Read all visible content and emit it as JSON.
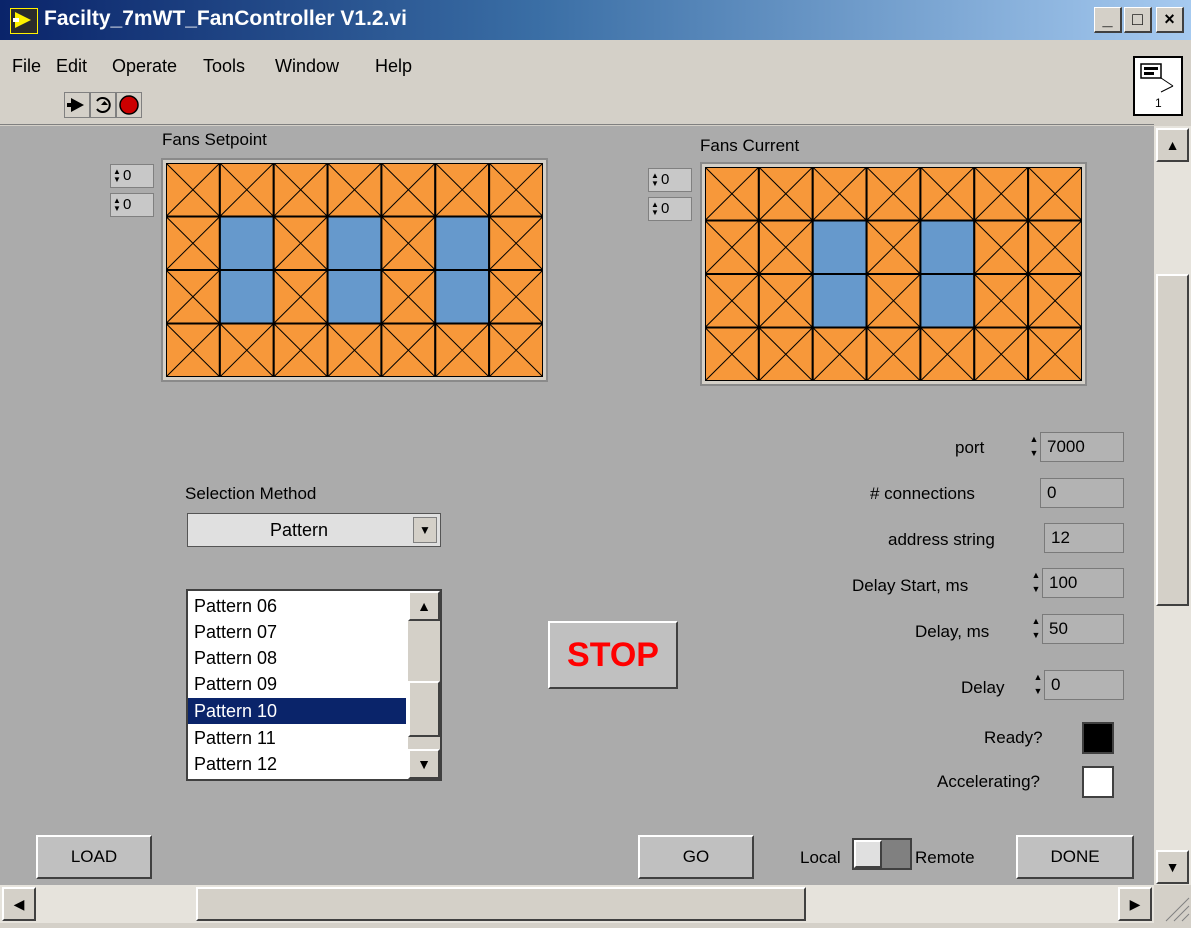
{
  "window": {
    "title": "Facilty_7mWT_FanController V1.2.vi",
    "controls": {
      "minimize": "_",
      "maximize": "□",
      "close": "×"
    }
  },
  "menu": [
    "File",
    "Edit",
    "Operate",
    "Tools",
    "Window",
    "Help"
  ],
  "toolbar": {
    "icons": [
      "run-icon",
      "run-continuously-icon",
      "abort-icon"
    ]
  },
  "vi_icon_label": "1",
  "fans_setpoint": {
    "label": "Fans Setpoint",
    "index_row": "0",
    "index_col": "0",
    "rows": 4,
    "cols": 7,
    "grid": [
      [
        0,
        0,
        0,
        0,
        0,
        0,
        0
      ],
      [
        0,
        1,
        0,
        1,
        0,
        1,
        0
      ],
      [
        0,
        1,
        0,
        1,
        0,
        1,
        0
      ],
      [
        0,
        0,
        0,
        0,
        0,
        0,
        0
      ]
    ]
  },
  "fans_current": {
    "label": "Fans Current",
    "index_row": "0",
    "index_col": "0",
    "rows": 4,
    "cols": 7,
    "grid": [
      [
        0,
        0,
        0,
        0,
        0,
        0,
        0
      ],
      [
        0,
        0,
        1,
        0,
        1,
        0,
        0
      ],
      [
        0,
        0,
        1,
        0,
        1,
        0,
        0
      ],
      [
        0,
        0,
        0,
        0,
        0,
        0,
        0
      ]
    ]
  },
  "colors": {
    "fan_off": "#f7983a",
    "fan_on": "#6699cc",
    "panel": "#ababab",
    "stop_text": "#ff0000",
    "list_selected": "#0a246a"
  },
  "selection_method": {
    "label": "Selection Method",
    "value": "Pattern"
  },
  "pattern_list": {
    "items": [
      "Pattern 06",
      "Pattern 07",
      "Pattern 08",
      "Pattern 09",
      "Pattern 10",
      "Pattern 11",
      "Pattern 12"
    ],
    "selected": "Pattern 10"
  },
  "stop_button": "STOP",
  "indicators": {
    "port": {
      "label": "port",
      "value": "7000"
    },
    "connections": {
      "label": "# connections",
      "value": "0"
    },
    "address": {
      "label": "address string",
      "value": "12"
    },
    "delay_start": {
      "label": "Delay Start, ms",
      "value": "100"
    },
    "delay_ms": {
      "label": "Delay, ms",
      "value": "50"
    },
    "delay": {
      "label": "Delay",
      "value": "0"
    },
    "ready": {
      "label": "Ready?",
      "state": true
    },
    "accelerating": {
      "label": "Accelerating?",
      "state": false
    }
  },
  "bottom": {
    "load": "LOAD",
    "go": "GO",
    "local": "Local",
    "remote": "Remote",
    "done": "DONE"
  }
}
